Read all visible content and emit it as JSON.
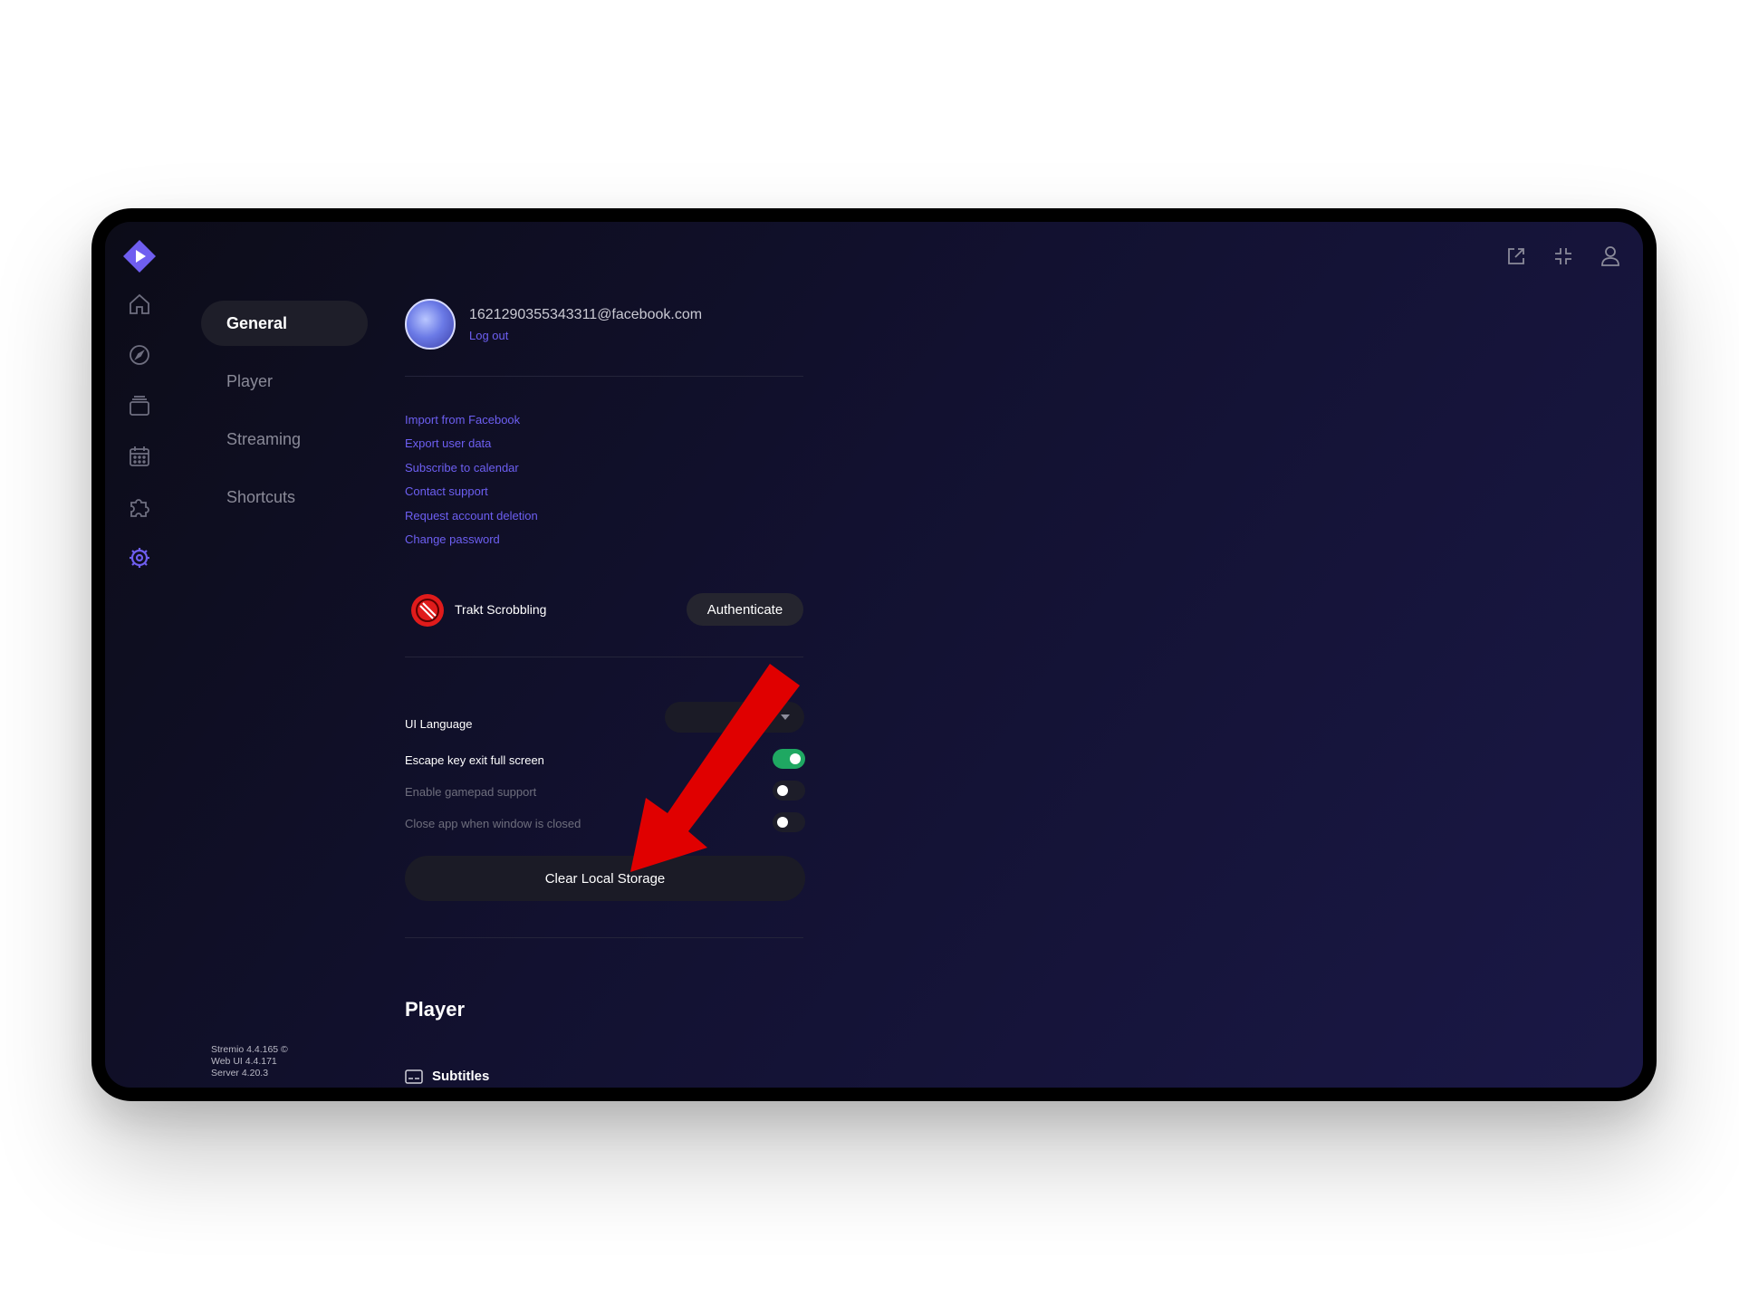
{
  "sidebar": {
    "items": [
      {
        "name": "home-icon"
      },
      {
        "name": "compass-icon"
      },
      {
        "name": "library-icon"
      },
      {
        "name": "calendar-icon"
      },
      {
        "name": "puzzle-icon"
      },
      {
        "name": "gear-icon",
        "active": true
      }
    ]
  },
  "topbar": {
    "icons": [
      "external-link-icon",
      "minimize-icon",
      "user-icon"
    ]
  },
  "settings_menu": {
    "items": [
      "General",
      "Player",
      "Streaming",
      "Shortcuts"
    ],
    "active": "General"
  },
  "version_info": [
    "Stremio 4.4.165 ©",
    "Web UI 4.4.171",
    "Server 4.20.3"
  ],
  "account": {
    "email": "1621290355343311@facebook.com",
    "logout": "Log out"
  },
  "links": [
    "Import from Facebook",
    "Export user data",
    "Subscribe to calendar",
    "Contact support",
    "Request account deletion",
    "Change password"
  ],
  "trakt": {
    "label": "Trakt Scrobbling",
    "button": "Authenticate"
  },
  "options": {
    "ui_language": "UI Language",
    "escape_key": "Escape key exit full screen",
    "gamepad": "Enable gamepad support",
    "close_app": "Close app when window is closed"
  },
  "toggles": {
    "escape_key": true,
    "gamepad": false,
    "close_app": false
  },
  "clear_storage": "Clear Local Storage",
  "player_section": {
    "title": "Player",
    "subtitles": "Subtitles"
  },
  "colors": {
    "accent": "#6d5ff2",
    "toggle_on": "#1fa862",
    "annotation_arrow": "#e00000"
  }
}
